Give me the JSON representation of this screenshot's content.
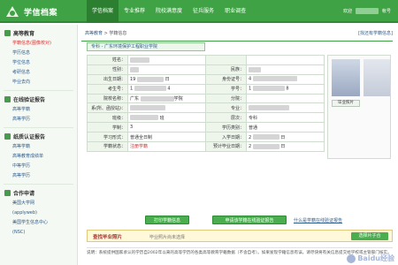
{
  "header": {
    "brand": "学信档案",
    "nav": [
      "学信档案",
      "专业推荐",
      "院校满意度",
      "征兵服务",
      "职业调查"
    ],
    "user_greeting": "欢迎",
    "user_extra": "帐号"
  },
  "sidebar": {
    "sections": [
      {
        "title": "高等教育",
        "items": [
          "学籍信息(图像校对)",
          "学历信息",
          "学位信息",
          "考研信息",
          "毕业去向"
        ]
      },
      {
        "title": "在线验证报告",
        "items": [
          "高等学籍",
          "高等学历"
        ]
      },
      {
        "title": "纸质认证报告",
        "items": [
          "高等学籍",
          "高等教育成绩单",
          "中等学历",
          "高等学历"
        ]
      },
      {
        "title": "合作申请",
        "items": [
          "美国大学网",
          "(applyweb)",
          "美国学生信息中心",
          "(NSC)"
        ]
      }
    ]
  },
  "main": {
    "breadcrumb_root": "高等教育",
    "breadcrumb_sep": " > ",
    "breadcrumb_current": "学籍信息",
    "back_link": "[找还有学籍信息]",
    "school_tab": "专科 - 广东环境保护工程职业学院",
    "rows": [
      {
        "l1": "姓名：",
        "v1": "",
        "l2": "",
        "v2": ""
      },
      {
        "l1": "性别：",
        "v1": "",
        "l2": "民族：",
        "v2": ""
      },
      {
        "l1": "出生日期：",
        "v1": "19",
        "v1b": "日",
        "l2": "身份证号：",
        "v2": "4"
      },
      {
        "l1": "考生号：",
        "v1": "1",
        "v1b": "4",
        "l2": "学号：",
        "v2": "1",
        "v2b": "8"
      },
      {
        "l1": "院校名称：",
        "v1": "广东",
        "v1b": "学院",
        "l2": "分院：",
        "v2": ""
      },
      {
        "l1": "系(所、函授站)：",
        "v1": "",
        "l2": "专业：",
        "v2": ""
      },
      {
        "l1": "班级：",
        "v1": "",
        "v1b": "班",
        "l2": "层次：",
        "v2": "专科"
      },
      {
        "l1": "学制：",
        "v1": "3",
        "l2": "学历类别：",
        "v2": "普通"
      },
      {
        "l1": "学习形式：",
        "v1": "普通全日制",
        "l2": "入学日期：",
        "v2": "2",
        "v2b": "日"
      },
      {
        "l1": "学籍状态：",
        "v1": "注册学籍",
        "l2": "预计毕业日期：",
        "v2": "2",
        "v2b": "日"
      }
    ],
    "photo_caption": "毕业照片",
    "btn_print": "打印学籍信息",
    "btn_apply": "申请该学籍在线验证报告",
    "link_what": "什么是学籍在线验证报告",
    "photo_bar": {
      "title": "查找毕业照片",
      "status": "毕业照片尚未选择",
      "button": "选择片子合"
    },
    "note": "说明：系统提供国家承认的学历自2002年以来的高等学历的各类高等教育学籍数据（不含自考）。如果发现学籍信息有误，请尽快将有关信息提交给学校或主管部门核实。"
  },
  "watermark": "Baidu经验",
  "colors": {
    "primary": "#3fa345",
    "accent_red": "#d03030",
    "link": "#2c5a8a"
  }
}
